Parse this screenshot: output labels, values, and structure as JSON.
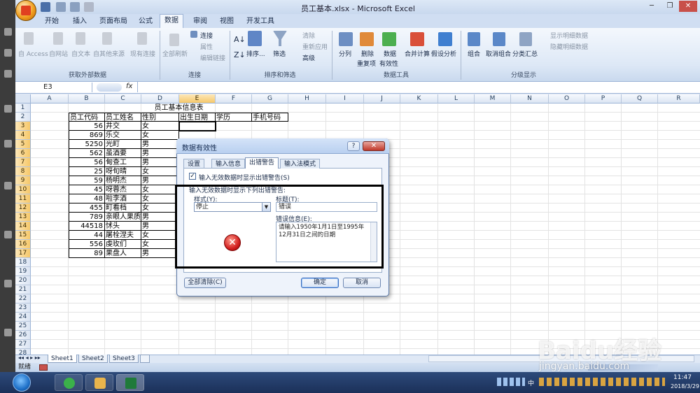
{
  "window": {
    "title": "员工基本.xlsx - Microsoft Excel"
  },
  "ribbon": {
    "tabs": [
      "开始",
      "插入",
      "页面布局",
      "公式",
      "数据",
      "审阅",
      "视图",
      "开发工具"
    ],
    "active_tab": "数据",
    "groups": {
      "external": {
        "label": "获取外部数据",
        "buttons": [
          "自 Access",
          "自网站",
          "自文本",
          "自其他来源",
          "现有连接"
        ]
      },
      "connections": {
        "label": "连接",
        "buttons": [
          "全部刷新",
          "连接",
          "属性",
          "编辑链接"
        ]
      },
      "sort_filter": {
        "label": "排序和筛选",
        "buttons": [
          "排序...",
          "筛选",
          "清除",
          "重新应用",
          "高级"
        ]
      },
      "data_tools": {
        "label": "数据工具",
        "buttons": [
          "分列",
          "删除",
          "重复项",
          "数据",
          "有效性",
          "合并计算",
          "假设分析"
        ]
      },
      "outline": {
        "label": "分级显示",
        "buttons": [
          "组合",
          "取消组合",
          "分类汇总",
          "显示明细数据",
          "隐藏明细数据"
        ]
      }
    }
  },
  "formula": {
    "name_box": "E3",
    "fx": "fx",
    "value": ""
  },
  "grid": {
    "columns": [
      "A",
      "B",
      "C",
      "D",
      "E",
      "F",
      "G",
      "H",
      "I",
      "J",
      "K",
      "L",
      "M",
      "N",
      "O",
      "P",
      "Q",
      "R"
    ],
    "selected_column": "E",
    "selected_rows": [
      "3",
      "4",
      "5",
      "6",
      "7",
      "8",
      "9",
      "10",
      "11",
      "12",
      "13",
      "14",
      "15",
      "16",
      "17"
    ],
    "rows": [
      "1",
      "2",
      "3",
      "4",
      "5",
      "6",
      "7",
      "8",
      "9",
      "10",
      "11",
      "12",
      "13",
      "14",
      "15",
      "16",
      "17",
      "18",
      "19",
      "20",
      "21",
      "22",
      "23",
      "24",
      "25",
      "26",
      "27",
      "28"
    ],
    "table_title": "员工基本信息表",
    "headers": [
      "员工代码",
      "员工姓名",
      "性别",
      "出生日期",
      "学历",
      "手机号码"
    ],
    "records": [
      [
        "56",
        "井交",
        "女"
      ],
      [
        "869",
        "乐交",
        "女"
      ],
      [
        "5250",
        "光町",
        "男"
      ],
      [
        "562",
        "虽酒要",
        "男"
      ],
      [
        "56",
        "甸查工",
        "男"
      ],
      [
        "25",
        "呀旬晴",
        "女"
      ],
      [
        "59",
        "杨明杰",
        "男"
      ],
      [
        "45",
        "呀蓉杰",
        "女"
      ],
      [
        "48",
        "啦李酒",
        "女"
      ],
      [
        "455",
        "町看档",
        "女"
      ],
      [
        "789",
        "亲眼人果质",
        "男"
      ],
      [
        "44518",
        "怵头",
        "男"
      ],
      [
        "44",
        "屠栓涅夫",
        "女"
      ],
      [
        "556",
        "虔玫们",
        "女"
      ],
      [
        "89",
        "果盘人",
        "男"
      ]
    ]
  },
  "sheets": {
    "tabs": [
      "Sheet1",
      "Sheet2",
      "Sheet3"
    ],
    "active": "Sheet1"
  },
  "status": {
    "ready": "就绪"
  },
  "dialog": {
    "title": "数据有效性",
    "help": "?",
    "close": "✕",
    "tabs": [
      "设置",
      "输入信息",
      "出错警告",
      "输入法模式"
    ],
    "active_tab": "出错警告",
    "checkbox_label": "输入无效数据时显示出错警告(S)",
    "checkbox_checked": true,
    "section_label": "输入无效数据时显示下列出错警告:",
    "style_label": "样式(Y):",
    "style_value": "停止",
    "title_label": "标题(T):",
    "title_value": "错误",
    "message_label": "错误信息(E):",
    "message_value": "请输入1950年1月1日至1995年12月31日之间的日期",
    "clear_all": "全部清除(C)",
    "ok": "确定",
    "cancel": "取消"
  },
  "taskbar": {
    "time": "11:47",
    "date": "2018/3/29",
    "tray": "中"
  },
  "watermark": {
    "line1": "Baidu经验",
    "line2": "jingyan.baidu.com"
  },
  "colors": {
    "accent": "#c0392b",
    "selection": "#f6c86a",
    "ribbon": "#dde8f6"
  }
}
